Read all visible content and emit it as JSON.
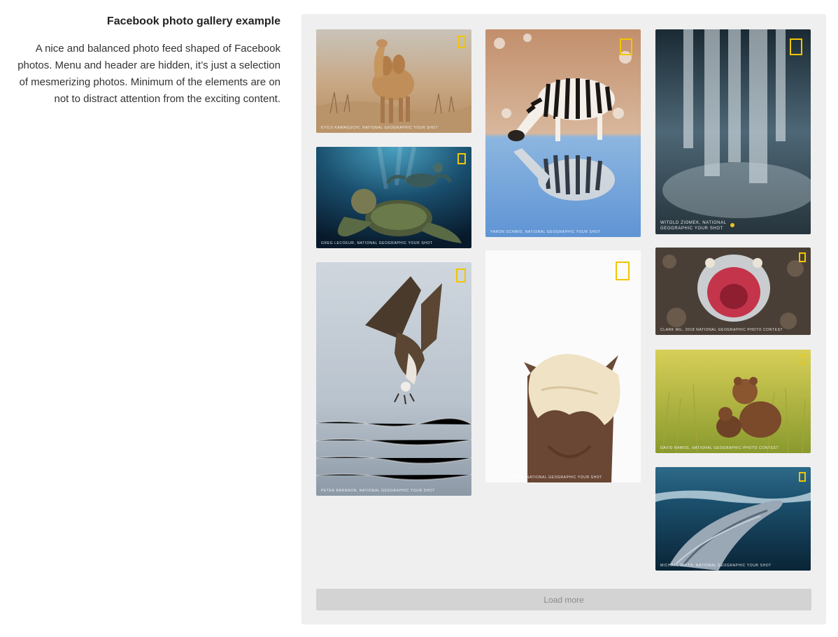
{
  "intro": {
    "title": "Facebook photo gallery example",
    "description": "A nice and balanced photo feed shaped of Facebook photos. Menu and header are hidden, it’s just a selection of mesmerizing photos. Minimum of the elements are on not to distract attention from the exciting content."
  },
  "gallery": {
    "photos": [
      {
        "subject": "camel",
        "caption": "KYOJI KAWAGUCHI, NATIONAL GEOGRAPHIC YOUR SHOT"
      },
      {
        "subject": "sea turtles",
        "caption": "GREG LECOEUR, NATIONAL GEOGRAPHIC YOUR SHOT"
      },
      {
        "subject": "osprey",
        "caption": "PETER BRANNON, NATIONAL GEOGRAPHIC YOUR SHOT"
      },
      {
        "subject": "zebra",
        "caption": "YARON SCHMID, NATIONAL GEOGRAPHIC YOUR SHOT"
      },
      {
        "subject": "horse",
        "caption": "IRIS BERGMANN, NATIONAL GEOGRAPHIC YOUR SHOT"
      },
      {
        "subject": "waterfall",
        "caption": "WITOLD ZIOMEK, NATIONAL GEOGRAPHIC YOUR SHOT"
      },
      {
        "subject": "lizardfish",
        "caption": "CLARK MIL, 2018 NATIONAL GEOGRAPHIC PHOTO CONTEST"
      },
      {
        "subject": "bear cubs",
        "caption": "DAVID RAMOS, NATIONAL GEOGRAPHIC PHOTO CONTEST"
      },
      {
        "subject": "humpback whale",
        "caption": "MICHAEL SMITH, NATIONAL GEOGRAPHIC YOUR SHOT"
      }
    ],
    "brand_color": "#f2c500",
    "load_more_label": "Load more"
  }
}
